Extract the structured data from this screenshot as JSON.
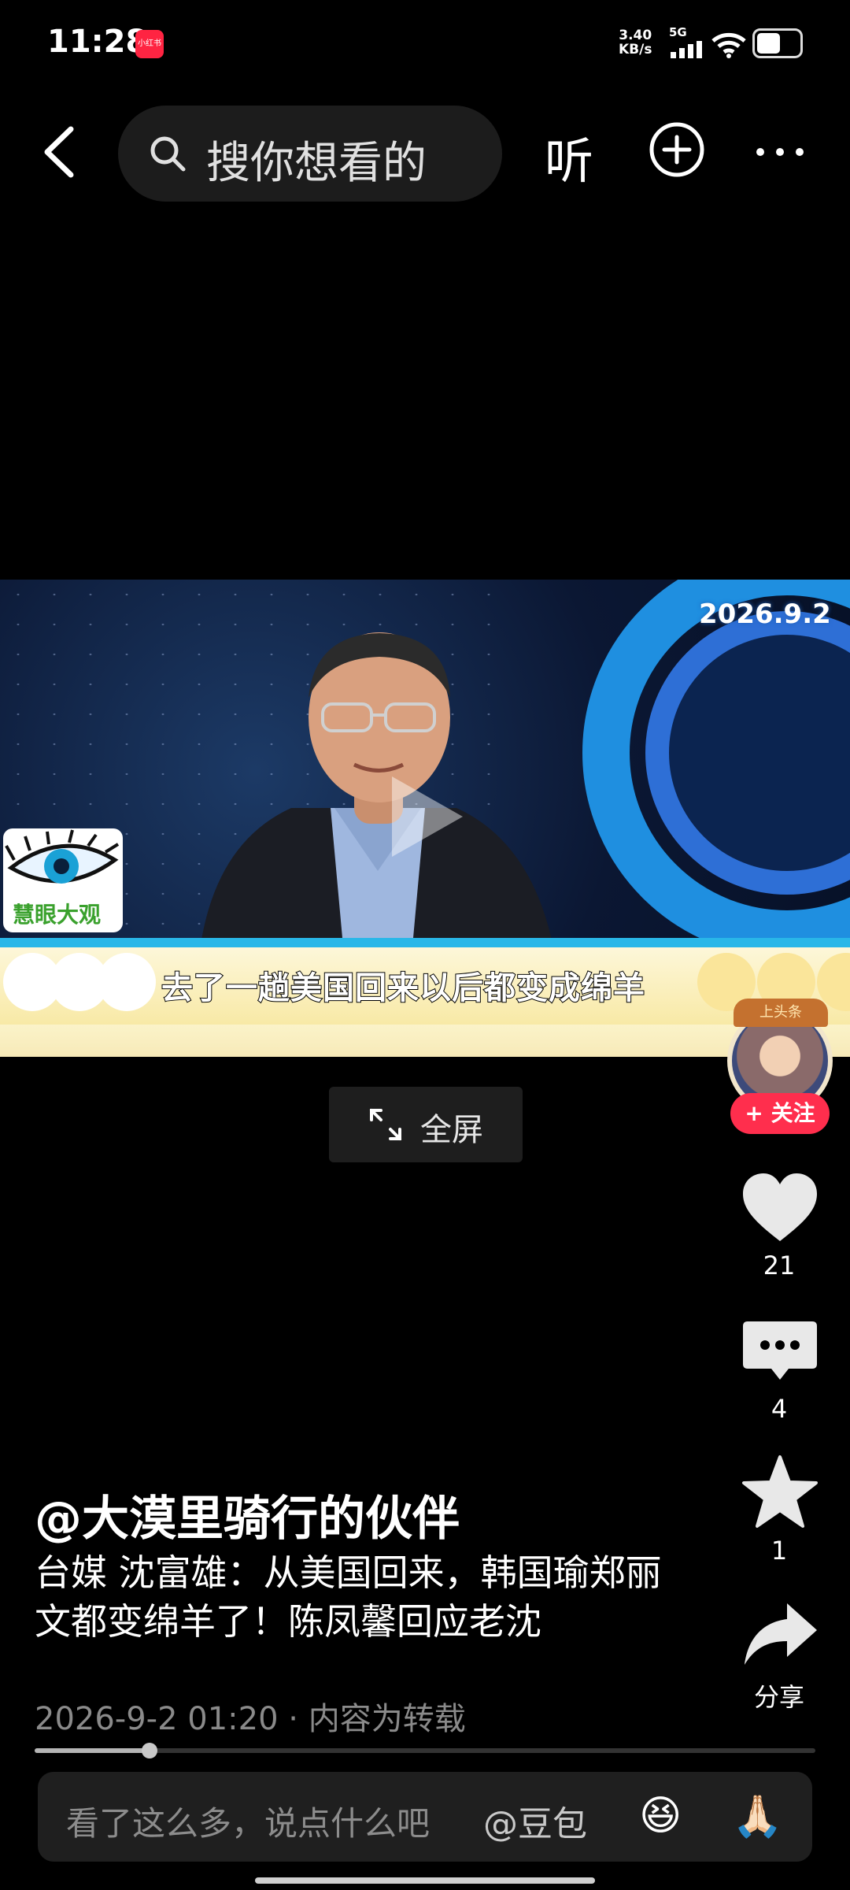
{
  "status_bar": {
    "time": "11:28",
    "app_badge": "小红书",
    "net_speed_value": "3.40",
    "net_speed_unit": "KB/s",
    "network": "5G",
    "battery_percent": 60
  },
  "top_bar": {
    "search_placeholder": "搜你想看的",
    "listen_label": "听"
  },
  "video": {
    "date_tag": "2026.9.2",
    "logo_text": "慧眼大观",
    "subtitle": "去了一趟美国回来以后都变成绵羊",
    "fullscreen_label": "全屏"
  },
  "right_rail": {
    "follow_label": "+ 关注",
    "avatar_badge": "上头条",
    "likes": "21",
    "comments": "4",
    "favorites": "1",
    "share_label": "分享"
  },
  "caption": {
    "author": "@大漠里骑行的伙伴",
    "description": "台媒  沈富雄：从美国回来，韩国瑜郑丽文都变绵羊了！陈凤馨回应老沈",
    "meta": "2026-9-2 01:20 · 内容为转载"
  },
  "playback": {
    "progress_fraction": 0.147
  },
  "comment_bar": {
    "placeholder": "看了这么多，说点什么吧",
    "mention": "@豆包",
    "emoji_1": "😆",
    "emoji_2": "🙏🏻"
  },
  "colors": {
    "follow_red": "#ff2e4d",
    "background": "#000000"
  }
}
